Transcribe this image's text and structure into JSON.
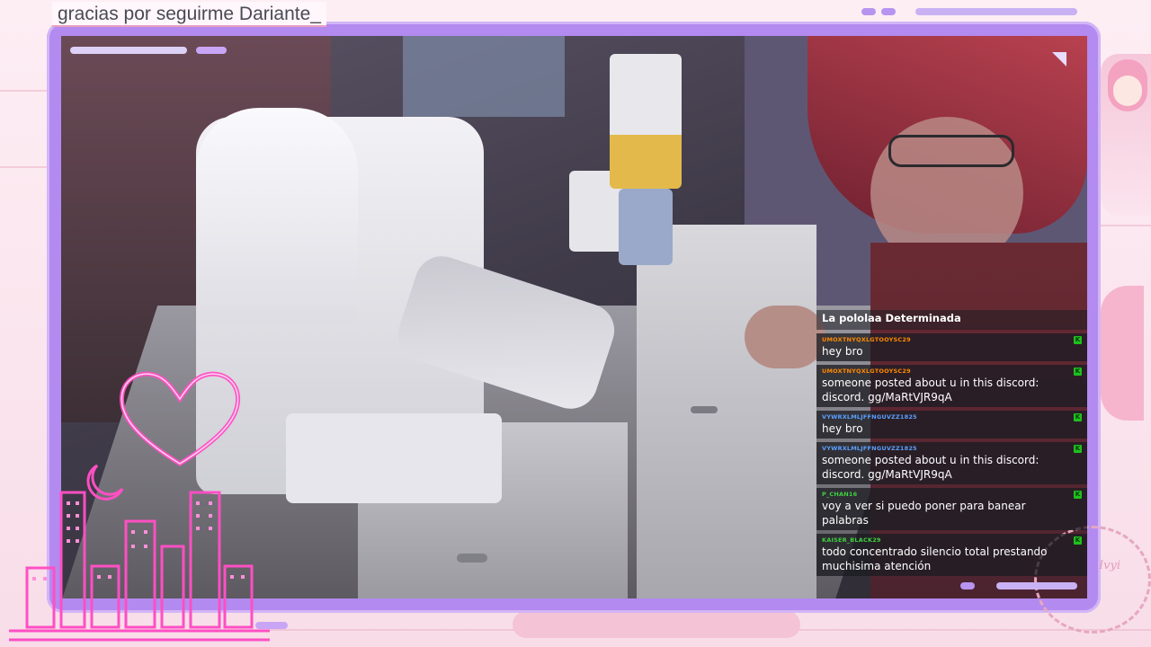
{
  "overlay": {
    "follower_alert": "gracias por seguirme Dariante_",
    "stamp_text": "Ivyi"
  },
  "chat": {
    "channel_name": "La pololaa Determinada",
    "messages": [
      {
        "user": "UMOXTNYQXLGTOOYSC29",
        "user_color": "#ff8a00",
        "text": "hey bro"
      },
      {
        "user": "UMOXTNYQXLGTOOYSC29",
        "user_color": "#ff8a00",
        "text": "someone posted about u in this discord: discord. gg/MaRtVJR9qA"
      },
      {
        "user": "VYWRXLMLJFFNGUVZZ1825",
        "user_color": "#5aa0ff",
        "text": "hey bro"
      },
      {
        "user": "VYWRXLMLJFFNGUVZZ1825",
        "user_color": "#5aa0ff",
        "text": "someone posted about u in this discord: discord. gg/MaRtVJR9qA"
      },
      {
        "user": "P_CHAN16",
        "user_color": "#3fd13f",
        "text": "voy a ver si puedo poner para banear palabras"
      },
      {
        "user": "KAISER_BLACK29",
        "user_color": "#3fd13f",
        "text": "todo concentrado silencio total prestando muchisima atención"
      }
    ],
    "badge_glyph": "K"
  },
  "colors": {
    "frame": "#b38af0",
    "neon_pink": "#ff4fc3",
    "accent_lilac": "#c9a6f5"
  },
  "icons": [
    "neon-heart-icon",
    "neon-moon-icon",
    "corner-triangle-icon",
    "mod-badge-icon"
  ]
}
